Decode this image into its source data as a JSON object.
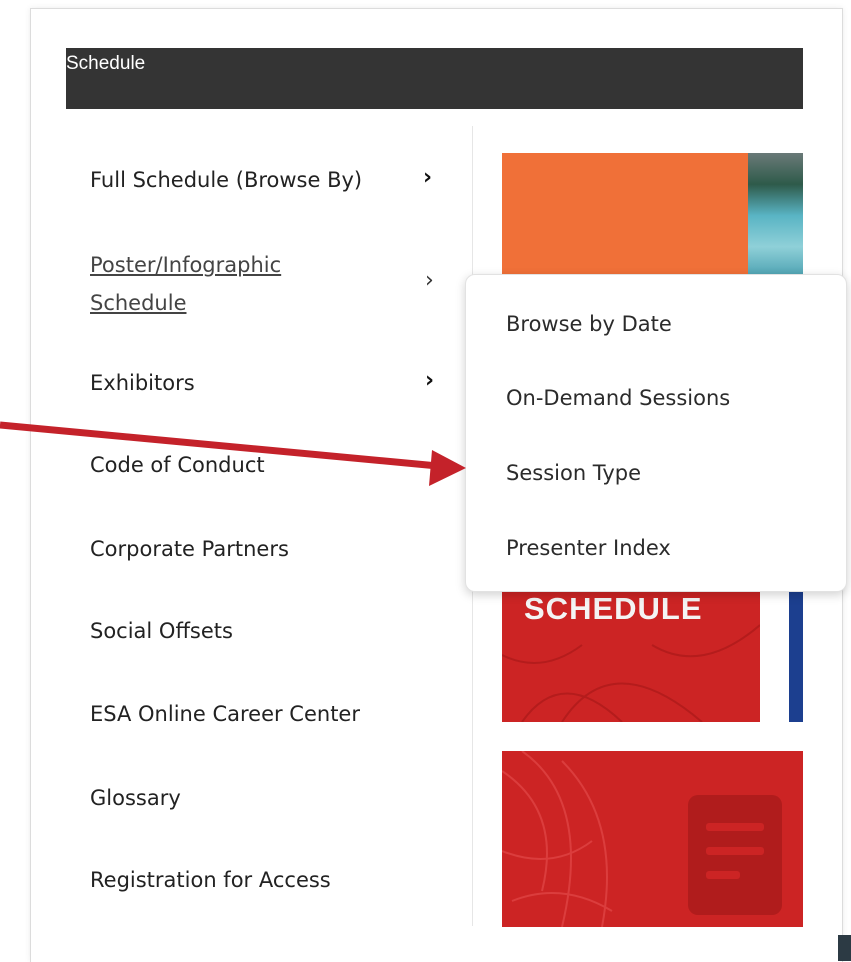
{
  "header": {
    "title": "Schedule"
  },
  "nav": {
    "items": [
      {
        "label": "Full Schedule (Browse By)",
        "chevron": "›"
      },
      {
        "label": "Poster/Infographic",
        "label2": "Schedule",
        "chevron": "›"
      },
      {
        "label": "Exhibitors",
        "chevron": "›"
      },
      {
        "label": "Code of Conduct"
      },
      {
        "label": "Corporate Partners"
      },
      {
        "label": "Social Offsets"
      },
      {
        "label": "ESA Online Career Center"
      },
      {
        "label": "Glossary"
      },
      {
        "label": "Registration for Access"
      }
    ]
  },
  "submenu": {
    "items": [
      "Browse by Date",
      "On-Demand Sessions",
      "Session Type",
      "Presenter Index"
    ]
  },
  "tiles": {
    "schedule_label": "SCHEDULE"
  },
  "colors": {
    "header": "#343434",
    "orange": "#f07038",
    "red": "#cc2424",
    "blue": "#1c3f8f",
    "annotation_arrow": "#c4222a"
  },
  "icons": {
    "chevron": "chevron-right-icon",
    "arrow": "annotation-arrow-icon"
  }
}
